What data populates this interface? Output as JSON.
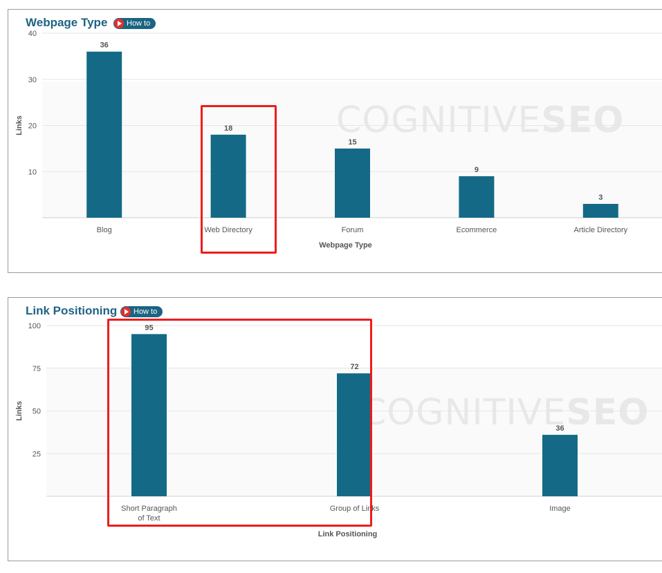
{
  "colors": {
    "bar": "#146a86",
    "title": "#1f6383",
    "howto_bg": "#1b6482",
    "howto_icon": "#e0312e",
    "highlight": "#ee1c1c",
    "watermark": "#e8e8e8"
  },
  "icons": {
    "howto": "play-circle-icon"
  },
  "charts": [
    {
      "title": "Webpage Type",
      "howto_label": "How to",
      "watermark": {
        "light": "COGNITIVE",
        "bold": "SEO"
      }
    },
    {
      "title": "Link Positioning",
      "howto_label": "How to",
      "watermark": {
        "light": "COGNITIVE",
        "bold": "SEO"
      }
    }
  ],
  "chart_data": [
    {
      "type": "bar",
      "title": "Webpage Type",
      "xlabel": "Webpage Type",
      "ylabel": "Links",
      "categories": [
        "Blog",
        "Web Directory",
        "Forum",
        "Ecommerce",
        "Article Directory"
      ],
      "values": [
        36,
        18,
        15,
        9,
        3
      ],
      "data_labels": [
        "36",
        "18",
        "15",
        "9",
        "3"
      ],
      "yticks": [
        10,
        20,
        30,
        40
      ],
      "ytick_labels": [
        "10",
        "20",
        "30",
        "40"
      ],
      "ylim": [
        0,
        40
      ],
      "grid": true,
      "highlighted_category": "Web Directory"
    },
    {
      "type": "bar",
      "title": "Link Positioning",
      "xlabel": "Link Positioning",
      "ylabel": "Links",
      "categories": [
        "Short Paragraph of Text",
        "Group of Links",
        "Image"
      ],
      "category_lines": [
        [
          "Short Paragraph",
          "of Text"
        ],
        [
          "Group of Links"
        ],
        [
          "Image"
        ]
      ],
      "values": [
        95,
        72,
        36
      ],
      "data_labels": [
        "95",
        "72",
        "36"
      ],
      "yticks": [
        25,
        50,
        75,
        100
      ],
      "ytick_labels": [
        "25",
        "50",
        "75",
        "100"
      ],
      "ylim": [
        0,
        100
      ],
      "grid": true,
      "highlighted_categories": [
        "Short Paragraph of Text",
        "Group of Links"
      ]
    }
  ]
}
